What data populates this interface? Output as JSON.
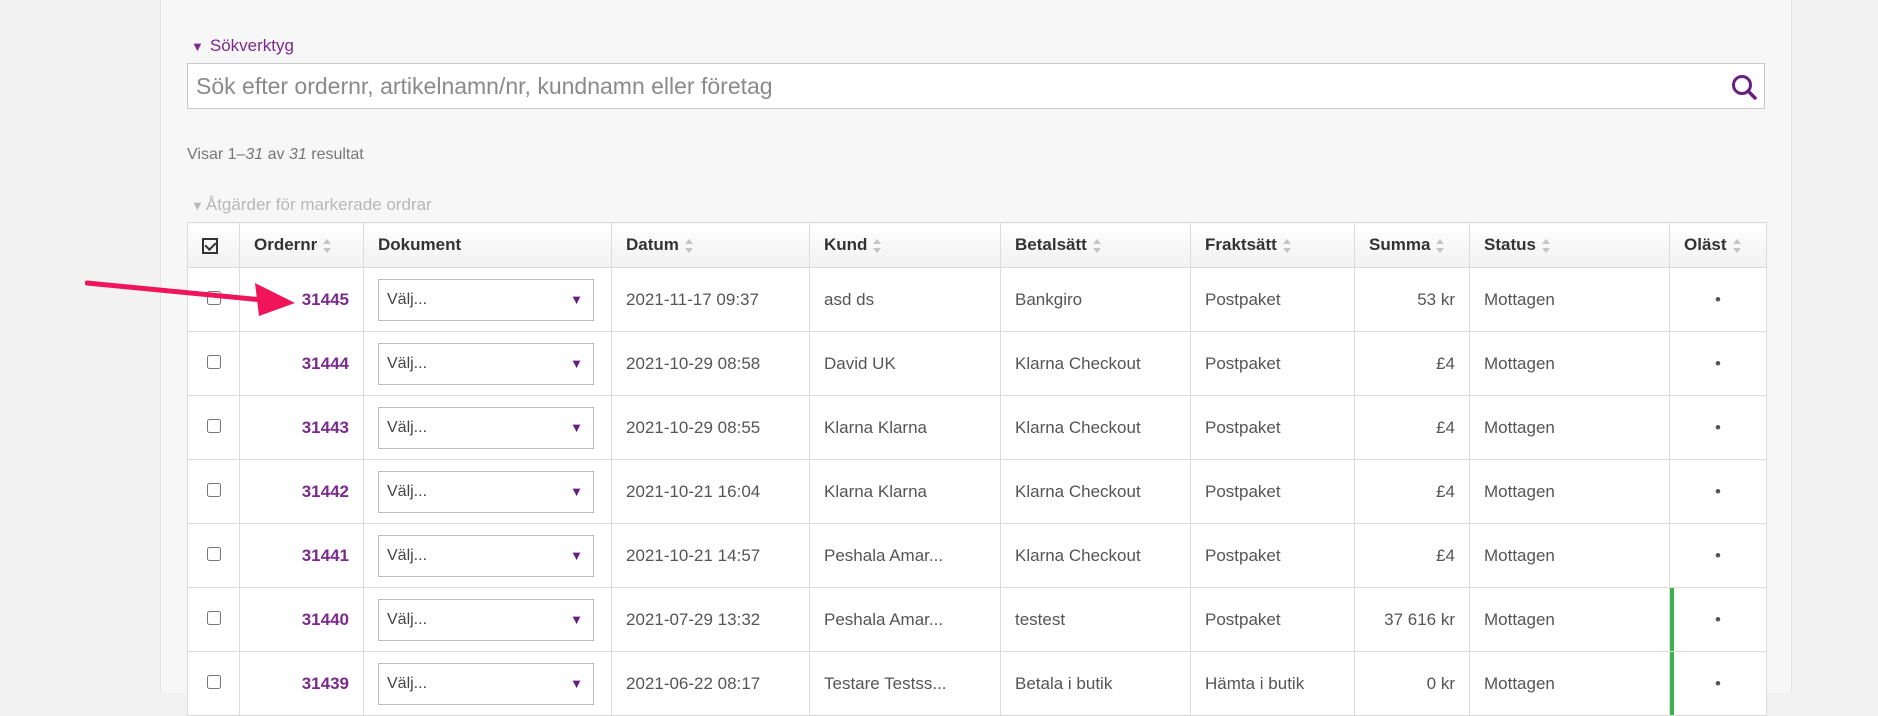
{
  "search_tools": {
    "toggle_label": "Sökverktyg",
    "placeholder": "Sök efter ordernr, artikelnamn/nr, kundnamn eller företag",
    "value": ""
  },
  "results": {
    "prefix": "Visar 1–",
    "shown": "31",
    "middle": " av ",
    "total": "31",
    "suffix": " resultat"
  },
  "bulk_actions": {
    "label": "Åtgärder för markerade ordrar"
  },
  "table": {
    "headers": {
      "ordernr": "Ordernr",
      "dokument": "Dokument",
      "datum": "Datum",
      "kund": "Kund",
      "betalsatt": "Betalsätt",
      "fraktsatt": "Fraktsätt",
      "summa": "Summa",
      "status": "Status",
      "olast": "Oläst"
    },
    "rows": [
      {
        "ordernr": "31445",
        "dokument": "Välj...",
        "datum": "2021-11-17 09:37",
        "kund": "asd ds",
        "betalsatt": "Bankgiro",
        "fraktsatt": "Postpaket",
        "summa": "53 kr",
        "status": "Mottagen",
        "olast": "•",
        "flag": false
      },
      {
        "ordernr": "31444",
        "dokument": "Välj...",
        "datum": "2021-10-29 08:58",
        "kund": "David UK",
        "betalsatt": "Klarna Checkout",
        "fraktsatt": "Postpaket",
        "summa": "£4",
        "status": "Mottagen",
        "olast": "•",
        "flag": false
      },
      {
        "ordernr": "31443",
        "dokument": "Välj...",
        "datum": "2021-10-29 08:55",
        "kund": "Klarna Klarna",
        "betalsatt": "Klarna Checkout",
        "fraktsatt": "Postpaket",
        "summa": "£4",
        "status": "Mottagen",
        "olast": "•",
        "flag": false
      },
      {
        "ordernr": "31442",
        "dokument": "Välj...",
        "datum": "2021-10-21 16:04",
        "kund": "Klarna Klarna",
        "betalsatt": "Klarna Checkout",
        "fraktsatt": "Postpaket",
        "summa": "£4",
        "status": "Mottagen",
        "olast": "•",
        "flag": false
      },
      {
        "ordernr": "31441",
        "dokument": "Välj...",
        "datum": "2021-10-21 14:57",
        "kund": "Peshala Amar...",
        "betalsatt": "Klarna Checkout",
        "fraktsatt": "Postpaket",
        "summa": "£4",
        "status": "Mottagen",
        "olast": "•",
        "flag": false
      },
      {
        "ordernr": "31440",
        "dokument": "Välj...",
        "datum": "2021-07-29 13:32",
        "kund": "Peshala Amar...",
        "betalsatt": "testest",
        "fraktsatt": "Postpaket",
        "summa": "37 616 kr",
        "status": "Mottagen",
        "olast": "•",
        "flag": true
      },
      {
        "ordernr": "31439",
        "dokument": "Välj...",
        "datum": "2021-06-22 08:17",
        "kund": "Testare Testss...",
        "betalsatt": "Betala i butik",
        "fraktsatt": "Hämta i butik",
        "summa": "0 kr",
        "status": "Mottagen",
        "olast": "•",
        "flag": true
      }
    ]
  },
  "colors": {
    "accent": "#7b2a8e",
    "annotation_arrow": "#f0145a",
    "unread_flag": "#3cb34a"
  }
}
